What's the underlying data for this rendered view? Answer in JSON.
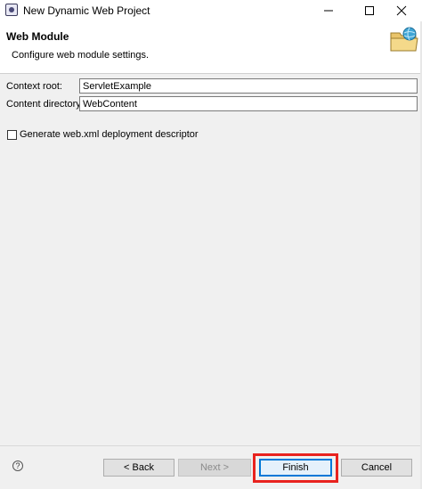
{
  "window": {
    "title": "New Dynamic Web Project"
  },
  "header": {
    "title": "Web Module",
    "description": "Configure web module settings."
  },
  "form": {
    "context_root": {
      "label": "Context root:",
      "value": "ServletExample"
    },
    "content_directory": {
      "label": "Content directory:",
      "value": "WebContent"
    },
    "generate_descriptor": {
      "label": "Generate web.xml deployment descriptor",
      "checked": false
    }
  },
  "buttons": {
    "help": "?",
    "back": "< Back",
    "next": "Next >",
    "finish": "Finish",
    "cancel": "Cancel"
  },
  "colors": {
    "highlight": "#e8221e",
    "focus": "#0078d7"
  }
}
